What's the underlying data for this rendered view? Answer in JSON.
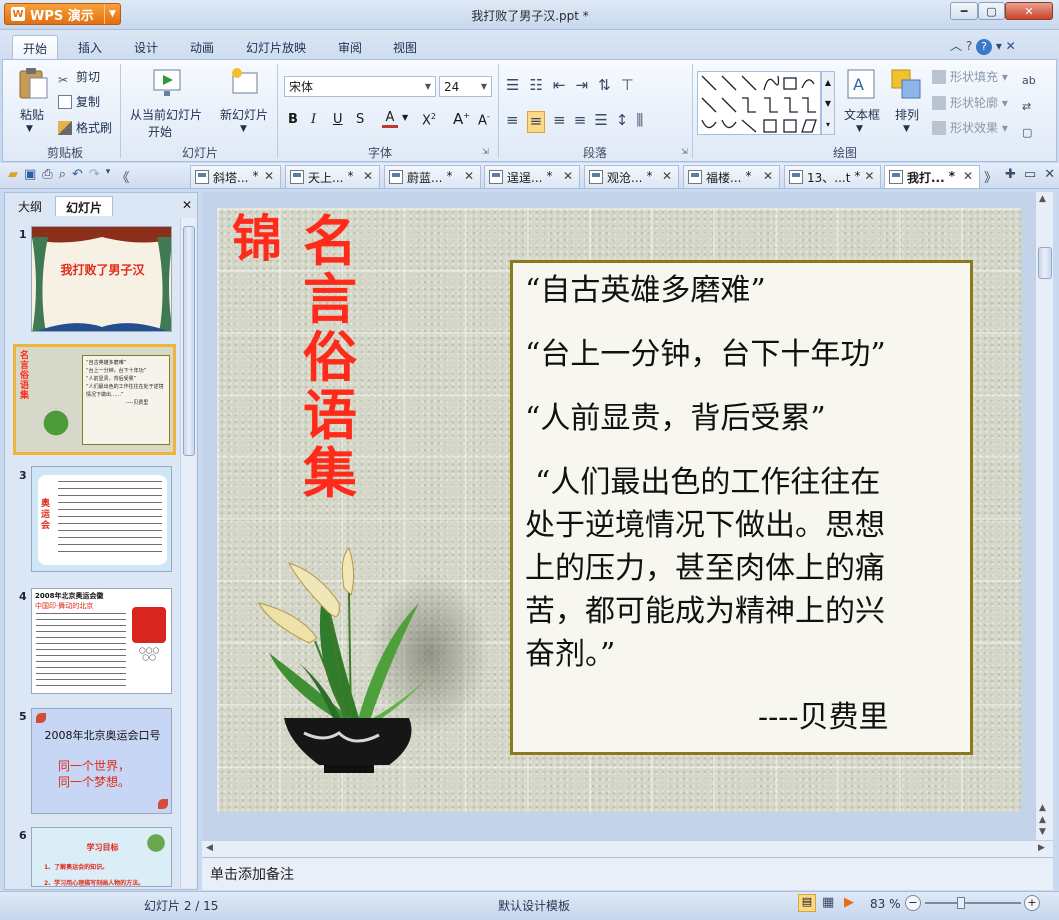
{
  "window": {
    "app_name": "WPS 演示",
    "title": "我打败了男子汉.ppt *"
  },
  "menu": [
    "开始",
    "插入",
    "设计",
    "动画",
    "幻灯片放映",
    "审阅",
    "视图"
  ],
  "ribbon": {
    "clipboard": {
      "paste": "粘贴",
      "cut": "剪切",
      "copy": "复制",
      "format_painter": "格式刷",
      "label": "剪贴板"
    },
    "slides": {
      "from_current_l1": "从当前幻灯片",
      "from_current_l2": "开始",
      "new_slide": "新幻灯片",
      "label": "幻灯片"
    },
    "font": {
      "name": "宋体",
      "size": "24",
      "label": "字体"
    },
    "paragraph": {
      "label": "段落"
    },
    "drawing": {
      "textbox": "文本框",
      "arrange": "排列",
      "shape_fill": "形状填充",
      "shape_outline": "形状轮廓",
      "shape_effect": "形状效果",
      "label": "绘图"
    }
  },
  "doc_tabs": [
    {
      "label": "斜塔...",
      "mark": "*"
    },
    {
      "label": "天上...",
      "mark": "*"
    },
    {
      "label": "蔚蓝...",
      "mark": "*"
    },
    {
      "label": "逞逞...",
      "mark": "*"
    },
    {
      "label": "观沧...",
      "mark": "*"
    },
    {
      "label": "福楼...",
      "mark": "*"
    },
    {
      "label": "13、...t",
      "mark": "*"
    },
    {
      "label": "我打...",
      "mark": "*"
    }
  ],
  "panel": {
    "tab_outline": "大纲",
    "tab_slides": "幻灯片"
  },
  "thumbnails": [
    {
      "num": "1",
      "text": "我打败了男子汉"
    },
    {
      "num": "2",
      "text": "名言俗语集"
    },
    {
      "num": "3",
      "text": "奥运会"
    },
    {
      "num": "4",
      "text": "2008年北京奥运会徽",
      "sub": "中国印·舞动的北京"
    },
    {
      "num": "5",
      "text": "2008年北京奥运会口号",
      "line1": "同一个世界，",
      "line2": "同一个梦想。"
    },
    {
      "num": "6",
      "text": "学习目标",
      "sub": "1、了解奥运会的知识。",
      "sub2": "2、学习用心理描写刻画人物的方法。"
    }
  ],
  "slide": {
    "title_col1": "锦",
    "title_col2": "名言俗语集",
    "quotes": [
      "“自古英雄多磨难”",
      "“台上一分钟，台下十年功”",
      "“人前显贵，背后受累”"
    ],
    "long_quote": [
      "“人们最出色的工作往往在",
      "处于逆境情况下做出。思想",
      "上的压力，甚至肉体上的痛",
      "苦，都可能成为精神上的兴",
      "奋剂。”"
    ],
    "author": "----贝费里"
  },
  "notes_placeholder": "单击添加备注",
  "status": {
    "slide_counter": "幻灯片 2 / 15",
    "template": "默认设计模板",
    "zoom": "83 %"
  },
  "colors": {
    "accent_title": "#ff2a1a",
    "frame": "#8a7a1c",
    "selection": "#f0b33a",
    "wps_orange": "#e46f10"
  }
}
